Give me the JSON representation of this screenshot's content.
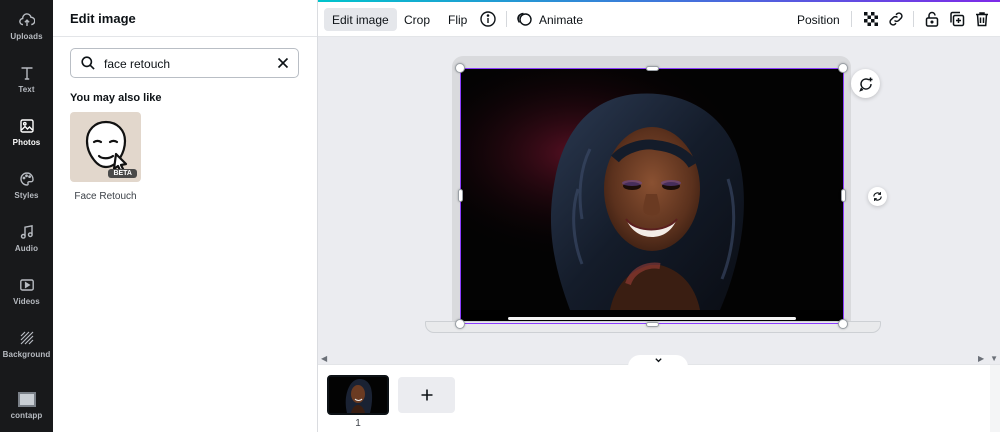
{
  "rail": {
    "items": [
      {
        "label": "Uploads",
        "icon": "upload-cloud-icon"
      },
      {
        "label": "Text",
        "icon": "text-T-icon"
      },
      {
        "label": "Photos",
        "icon": "image-icon"
      },
      {
        "label": "Styles",
        "icon": "palette-icon"
      },
      {
        "label": "Audio",
        "icon": "music-note-icon"
      },
      {
        "label": "Videos",
        "icon": "play-video-icon"
      },
      {
        "label": "Background",
        "icon": "diagonal-stripes-icon"
      },
      {
        "label": "contapp",
        "icon": "app-thumbnail-icon"
      }
    ],
    "active_index": 2
  },
  "panel": {
    "title": "Edit image",
    "search": {
      "value": "face retouch"
    },
    "section_label": "You may also like",
    "app": {
      "name": "Face Retouch",
      "badge": "BETA"
    }
  },
  "toolbar": {
    "edit_image": "Edit image",
    "crop": "Crop",
    "flip": "Flip",
    "animate": "Animate",
    "position": "Position"
  },
  "pages": {
    "current_page": "1"
  },
  "colors": {
    "accent": "#8b3dff",
    "rail_bg": "#18191b",
    "canvas_bg": "#ebecf0"
  }
}
